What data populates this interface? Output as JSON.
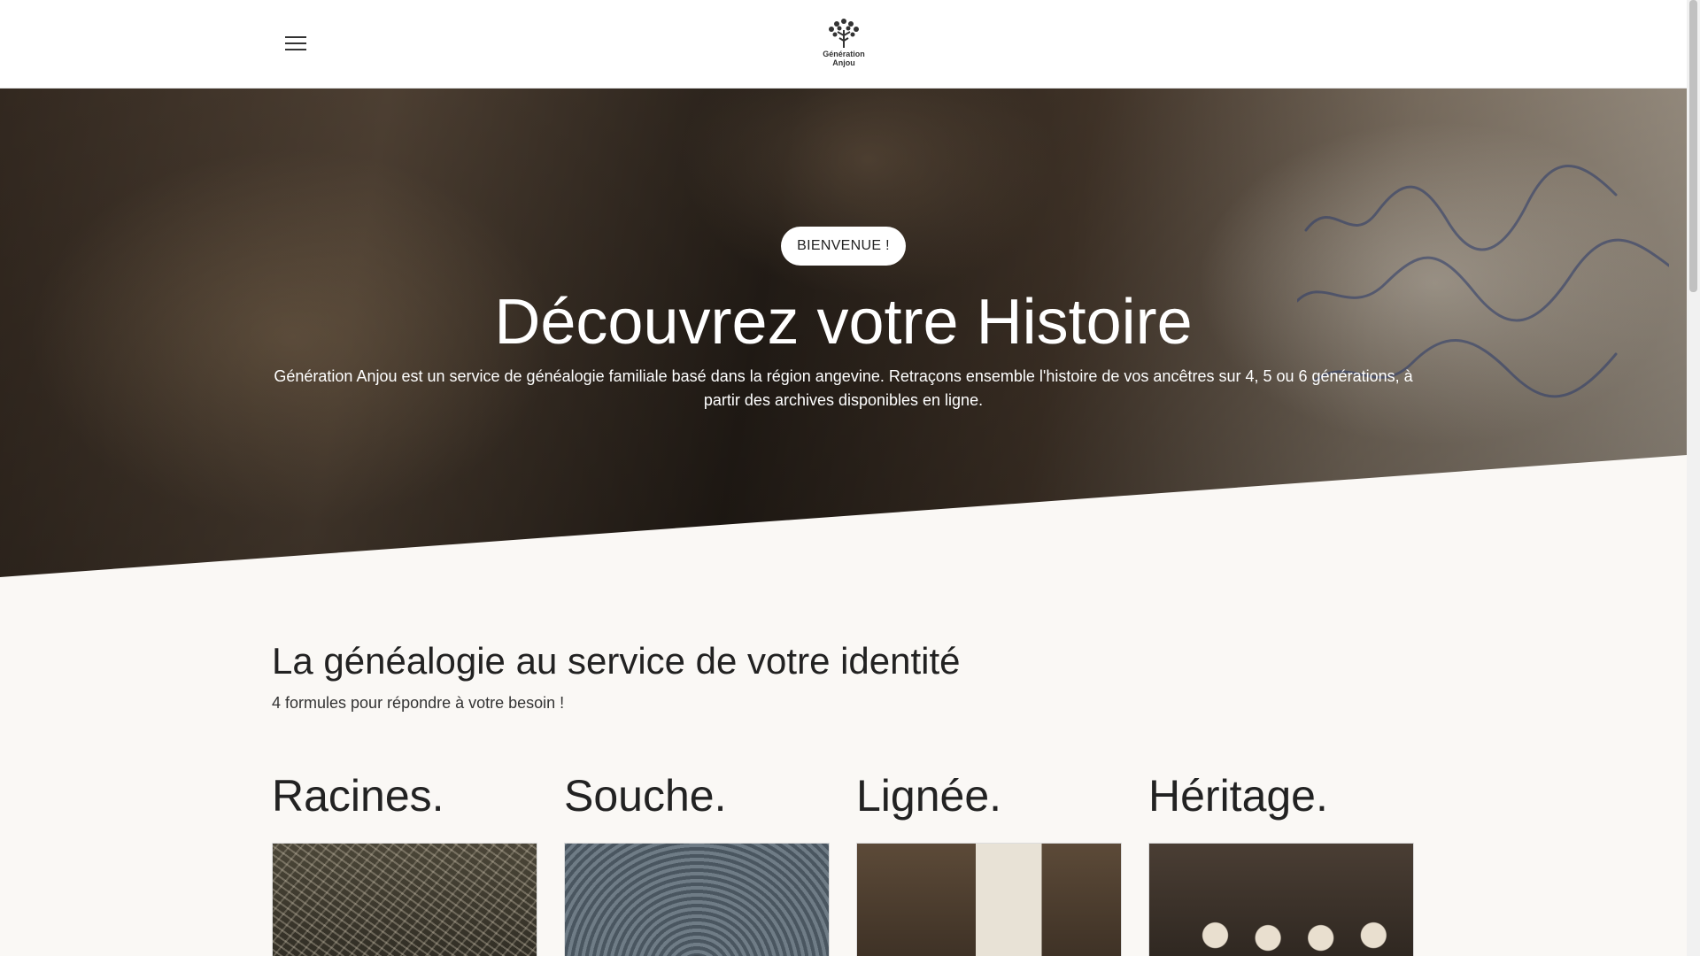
{
  "header": {
    "logo": {
      "line1": "Génération",
      "line2": "Anjou",
      "icon": "tree-icon"
    },
    "menu_icon": "hamburger-menu-icon"
  },
  "hero": {
    "badge": "BIENVENUE !",
    "title": "Découvrez votre Histoire",
    "text": "Génération Anjou est un service de généalogie familiale basé dans la région angevine. Retraçons ensemble l'histoire de vos ancêtres sur 4, 5 ou 6 générations, à partir des archives disponibles en ligne."
  },
  "section": {
    "title": "La généalogie au service de votre identité",
    "subtitle": "4 formules pour répondre à votre besoin !"
  },
  "formulas": [
    {
      "title": "Racines."
    },
    {
      "title": "Souche."
    },
    {
      "title": "Lignée."
    },
    {
      "title": "Héritage."
    }
  ],
  "colors": {
    "background": "#faf8f5",
    "header": "#ffffff",
    "text": "#222222",
    "badge": "#ffffff"
  }
}
